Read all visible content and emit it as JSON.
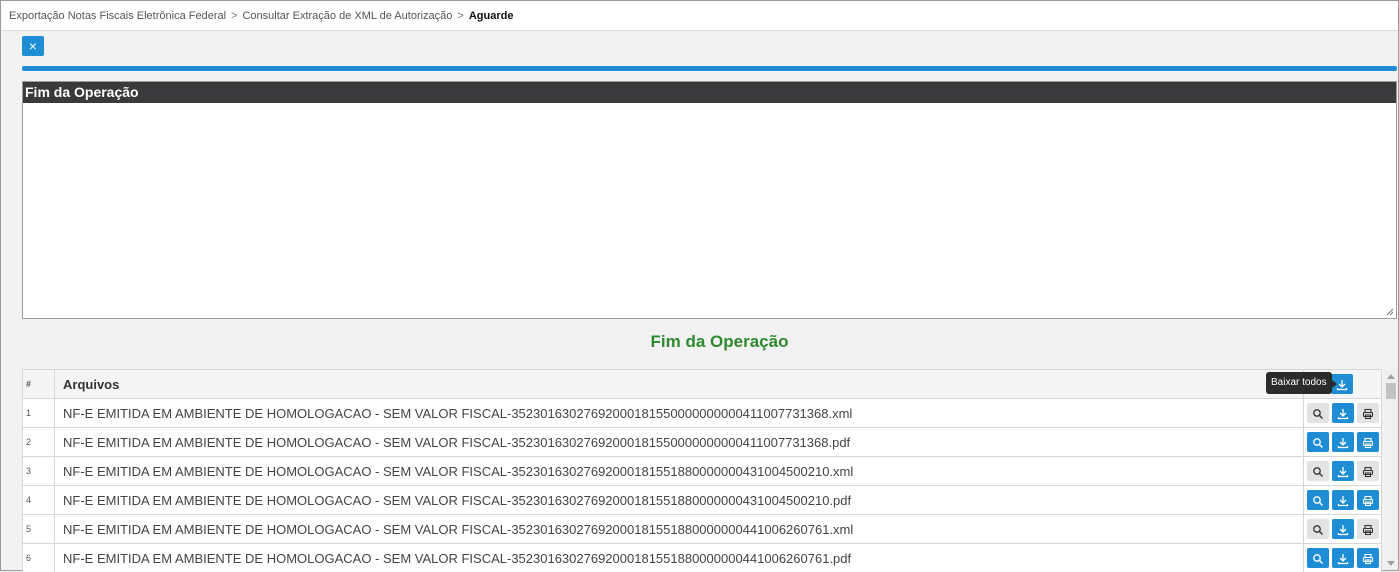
{
  "breadcrumb": {
    "items": [
      "Exportação Notas Fiscais Eletrônica Federal",
      "Consultar Extração de XML de Autorização"
    ],
    "separator": ">",
    "current": "Aguarde"
  },
  "close_button": {
    "icon": "×"
  },
  "progress": {
    "value": 1.0
  },
  "log": {
    "header": "Fim da Operação",
    "content": ""
  },
  "result_title": "Fim da Operação",
  "table": {
    "headers": {
      "number": "#",
      "files": "Arquivos"
    },
    "tooltip": "Baixar todos",
    "rows": [
      {
        "number": "1",
        "file": "NF-E EMITIDA EM AMBIENTE DE HOMOLOGACAO - SEM VALOR FISCAL-35230163027692000181550000000000411007731368.xml"
      },
      {
        "number": "2",
        "file": "NF-E EMITIDA EM AMBIENTE DE HOMOLOGACAO - SEM VALOR FISCAL-35230163027692000181550000000000411007731368.pdf"
      },
      {
        "number": "3",
        "file": "NF-E EMITIDA EM AMBIENTE DE HOMOLOGACAO - SEM VALOR FISCAL-35230163027692000181551880000000431004500210.xml"
      },
      {
        "number": "4",
        "file": "NF-E EMITIDA EM AMBIENTE DE HOMOLOGACAO - SEM VALOR FISCAL-35230163027692000181551880000000431004500210.pdf"
      },
      {
        "number": "5",
        "file": "NF-E EMITIDA EM AMBIENTE DE HOMOLOGACAO - SEM VALOR FISCAL-35230163027692000181551880000000441006260761.xml"
      },
      {
        "number": "6",
        "file": "NF-E EMITIDA EM AMBIENTE DE HOMOLOGACAO - SEM VALOR FISCAL-35230163027692000181551880000000441006260761.pdf"
      }
    ]
  },
  "colors": {
    "accent": "#1e8dd3",
    "success": "#2f8a2f",
    "header_dark": "#3a3a3c"
  }
}
